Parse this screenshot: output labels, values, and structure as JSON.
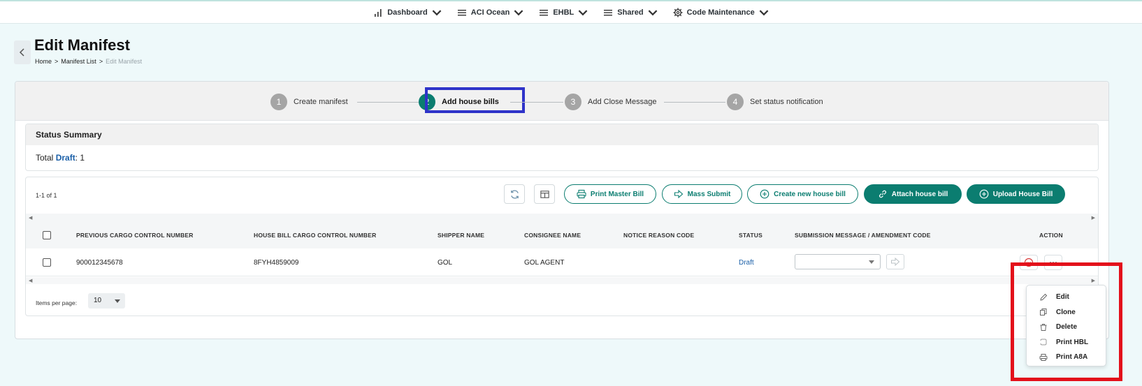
{
  "nav": {
    "items": [
      {
        "label": "Dashboard",
        "icon": "bar-chart-icon"
      },
      {
        "label": "ACI Ocean",
        "icon": "menu-lines-icon"
      },
      {
        "label": "EHBL",
        "icon": "menu-lines-icon"
      },
      {
        "label": "Shared",
        "icon": "menu-lines-icon"
      },
      {
        "label": "Code Maintenance",
        "icon": "gear-icon"
      }
    ]
  },
  "header": {
    "title": "Edit Manifest",
    "breadcrumb": [
      "Home",
      ">",
      "Manifest List",
      ">",
      "Edit Manifest"
    ]
  },
  "stepper": {
    "steps": [
      {
        "num": "1",
        "label": "Create manifest"
      },
      {
        "num": "2",
        "label": "Add house bills"
      },
      {
        "num": "3",
        "label": "Add Close Message"
      },
      {
        "num": "4",
        "label": "Set status notification"
      }
    ],
    "active_step": 2
  },
  "status_summary": {
    "title": "Status Summary",
    "total_label": "Total",
    "status_name": "Draft",
    "status_count": ": 1"
  },
  "table": {
    "count_text": "1-1 of 1",
    "toolbar": {
      "print_master": "Print Master Bill",
      "mass_submit": "Mass Submit",
      "create_new": "Create new house bill",
      "attach": "Attach house bill",
      "upload": "Upload House Bill"
    },
    "columns": [
      "PREVIOUS CARGO CONTROL NUMBER",
      "HOUSE BILL CARGO CONTROL NUMBER",
      "SHIPPER NAME",
      "CONSIGNEE NAME",
      "NOTICE REASON CODE",
      "STATUS",
      "SUBMISSION MESSAGE / AMENDMENT CODE",
      "ACTION"
    ],
    "rows": [
      {
        "prev_ccn": "900012345678",
        "hb_ccn": "8FYH4859009",
        "shipper": "GOL",
        "consignee": "GOL AGENT",
        "notice": "",
        "status": "Draft"
      }
    ],
    "items_per_page_label": "Items per page:",
    "items_per_page": "10"
  },
  "action_menu": {
    "items": [
      {
        "label": "Edit",
        "icon": "pencil-icon"
      },
      {
        "label": "Clone",
        "icon": "copy-icon"
      },
      {
        "label": "Delete",
        "icon": "trash-icon"
      },
      {
        "label": "Print HBL",
        "icon": "document-icon"
      },
      {
        "label": "Print A8A",
        "icon": "printer-icon"
      }
    ]
  },
  "colors": {
    "primary": "#0b7d70",
    "link": "#1a5fa8",
    "step_highlight": "#2f33c9",
    "menu_highlight": "#e3101b",
    "background": "#eef9fa"
  }
}
